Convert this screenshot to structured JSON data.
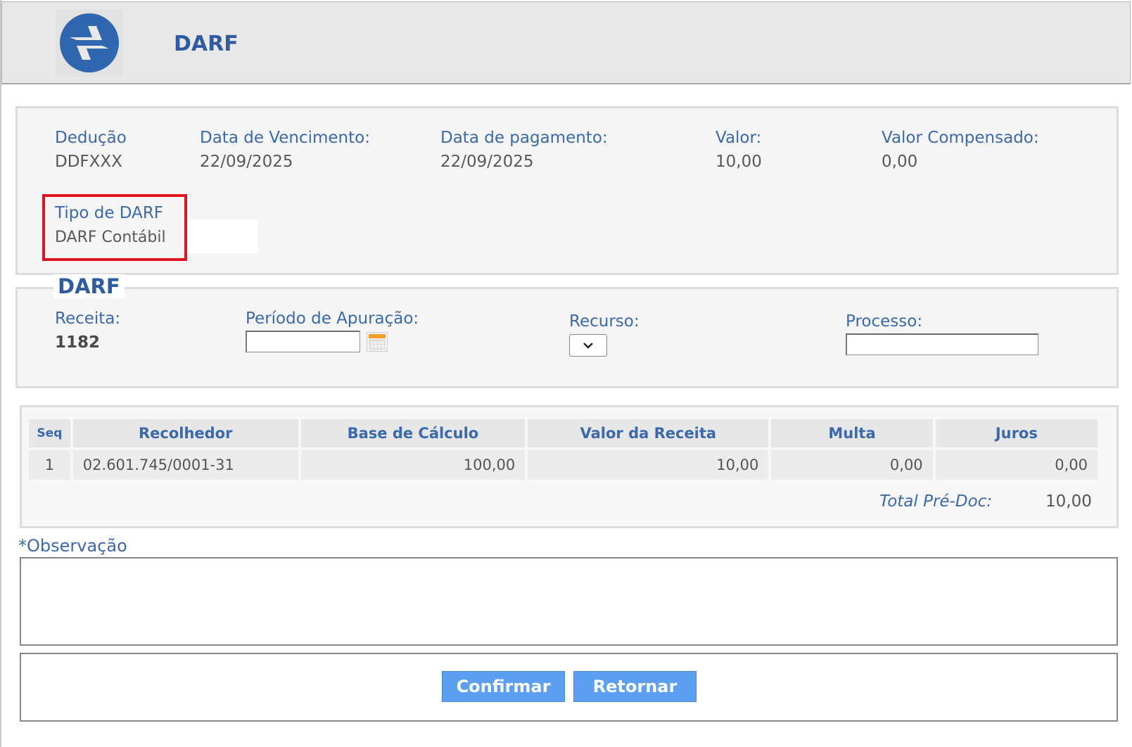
{
  "header": {
    "title": "DARF"
  },
  "info": {
    "deducao_label": "Dedução",
    "deducao_value": "DDFXXX",
    "vencimento_label": "Data de Vencimento:",
    "vencimento_value": "22/09/2025",
    "pagamento_label": "Data de pagamento:",
    "pagamento_value": "22/09/2025",
    "valor_label": "Valor:",
    "valor_value": "10,00",
    "compensado_label": "Valor Compensado:",
    "compensado_value": "0,00",
    "tipo_label": "Tipo de DARF",
    "tipo_value": "DARF Contábil"
  },
  "darf": {
    "legend": "DARF",
    "receita_label": "Receita:",
    "receita_value": "1182",
    "periodo_label": "Período de Apuração:",
    "periodo_value": "",
    "recurso_label": "Recurso:",
    "recurso_value": "",
    "processo_label": "Processo:",
    "processo_value": ""
  },
  "table": {
    "columns": [
      "Seq",
      "Recolhedor",
      "Base de Cálculo",
      "Valor da Receita",
      "Multa",
      "Juros"
    ],
    "rows": [
      {
        "seq": "1",
        "recolhedor": "02.601.745/0001-31",
        "base": "100,00",
        "valor": "10,00",
        "multa": "0,00",
        "juros": "0,00"
      }
    ],
    "total_label": "Total Pré-Doc:",
    "total_value": "10,00"
  },
  "observacao": {
    "label": "*Observação",
    "value": ""
  },
  "buttons": {
    "confirm": "Confirmar",
    "back": "Retornar"
  },
  "colors": {
    "accent": "#3b69ad",
    "button": "#5b9ff0",
    "highlight": "#e0141e",
    "header_bg": "#e8e8e8"
  },
  "icons": {
    "logo": "serpro-logo-icon",
    "calendar": "calendar-icon",
    "dropdown": "chevron-down-icon"
  }
}
